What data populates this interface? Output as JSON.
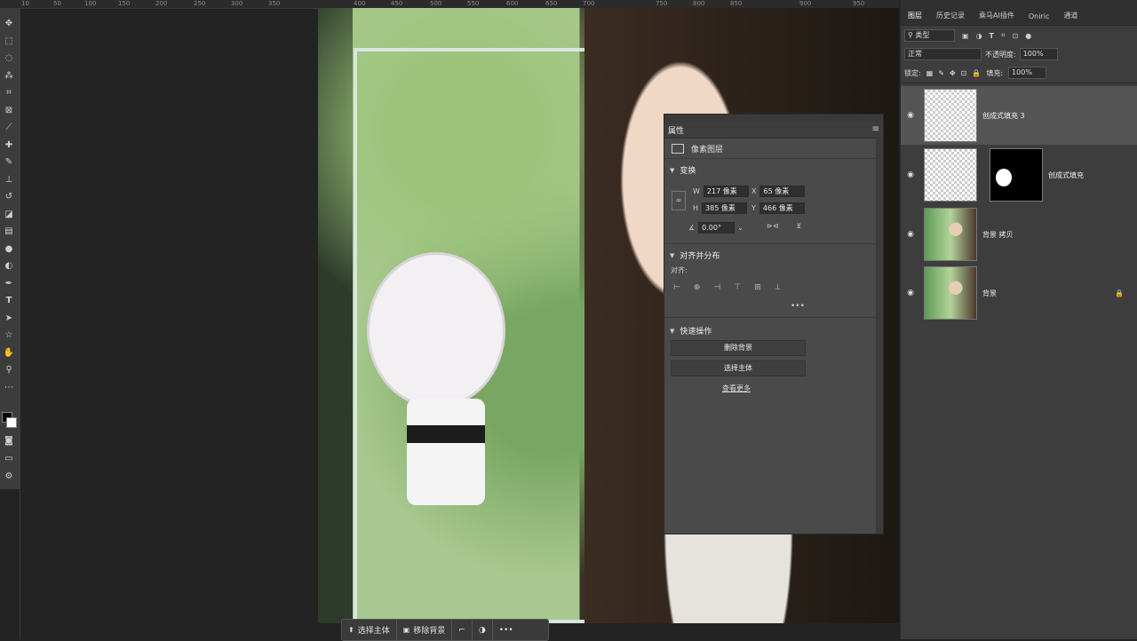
{
  "ruler": {
    "ticks": [
      "10",
      "50",
      "100",
      "150",
      "200",
      "250",
      "300",
      "350",
      "400",
      "450",
      "500",
      "550",
      "600",
      "650",
      "700",
      "750",
      "800",
      "850",
      "900",
      "950"
    ]
  },
  "tools": [
    "move-icon",
    "marquee-icon",
    "lasso-icon",
    "magic-wand-icon",
    "crop-icon",
    "frame-icon",
    "eyedropper-icon",
    "healing-icon",
    "brush-icon",
    "stamp-icon",
    "history-brush-icon",
    "eraser-icon",
    "gradient-icon",
    "blur-icon",
    "dodge-icon",
    "pen-icon",
    "type-icon",
    "path-select-icon",
    "shape-icon",
    "hand-icon",
    "zoom-icon",
    "more-icon"
  ],
  "properties_panel": {
    "tab_label": "属性",
    "kind_label": "像素图层",
    "transform": {
      "title": "变换",
      "w_label": "W",
      "w_value": "217 像素",
      "h_label": "H",
      "h_value": "385 像素",
      "x_label": "X",
      "x_value": "65 像素",
      "y_label": "Y",
      "y_value": "466 像素",
      "angle_value": "0.00°"
    },
    "align": {
      "title": "对齐并分布",
      "sub_label": "对齐:",
      "more": "•••"
    },
    "quick": {
      "title": "快速操作",
      "remove_bg": "删除背景",
      "select_subject": "选择主体",
      "see_more": "查看更多"
    }
  },
  "bottom_bar": {
    "select_subject": "选择主体",
    "remove_bg": "移除背景",
    "more": "•••"
  },
  "layers_panel": {
    "tabs": [
      "图层",
      "历史记录",
      "乘马AI插件",
      "Oniric",
      "通道"
    ],
    "filter_label": "类型",
    "blend_mode": "正常",
    "opacity_label": "不透明度:",
    "opacity_value": "100%",
    "lock_label": "锁定:",
    "fill_label": "填充:",
    "fill_value": "100%",
    "layers": [
      {
        "name": "创成式填充 3"
      },
      {
        "name": "创成式填充"
      },
      {
        "name": "背景 拷贝"
      },
      {
        "name": "背景"
      }
    ]
  }
}
